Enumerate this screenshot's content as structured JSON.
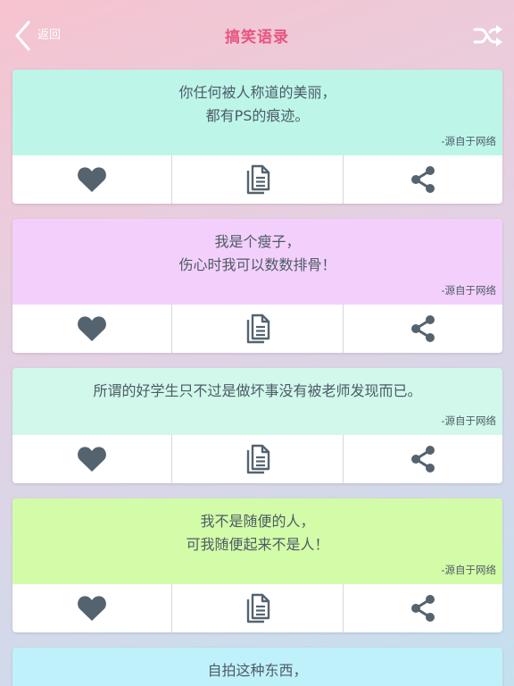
{
  "header": {
    "back_label": "返回",
    "title": "搞笑语录"
  },
  "icons": {
    "back": "chevron-left-icon",
    "shuffle": "shuffle-icon",
    "like": "heart-icon",
    "copy": "copy-document-icon",
    "share": "share-icon"
  },
  "colors": {
    "title": "#e8557f",
    "icon": "#55636f",
    "text": "#4d5b66",
    "card_backgrounds": [
      "#bdf6e9",
      "#f3d0fb",
      "#d1f8ea",
      "#d3fca8",
      "#bff1fb"
    ]
  },
  "cards": [
    {
      "line1": "你任何被人称道的美丽，",
      "line2": "都有PS的痕迹。",
      "source": "-源自于网络"
    },
    {
      "line1": "我是个瘦子，",
      "line2": "伤心时我可以数数排骨！",
      "source": "-源自于网络"
    },
    {
      "line1": "所谓的好学生只不过是做坏事没有被老师发现而已。",
      "line2": "",
      "source": "-源自于网络"
    },
    {
      "line1": "我不是随便的人，",
      "line2": "可我随便起来不是人！",
      "source": "-源自于网络"
    },
    {
      "line1": "自拍这种东西，",
      "line2": "",
      "source": ""
    }
  ]
}
